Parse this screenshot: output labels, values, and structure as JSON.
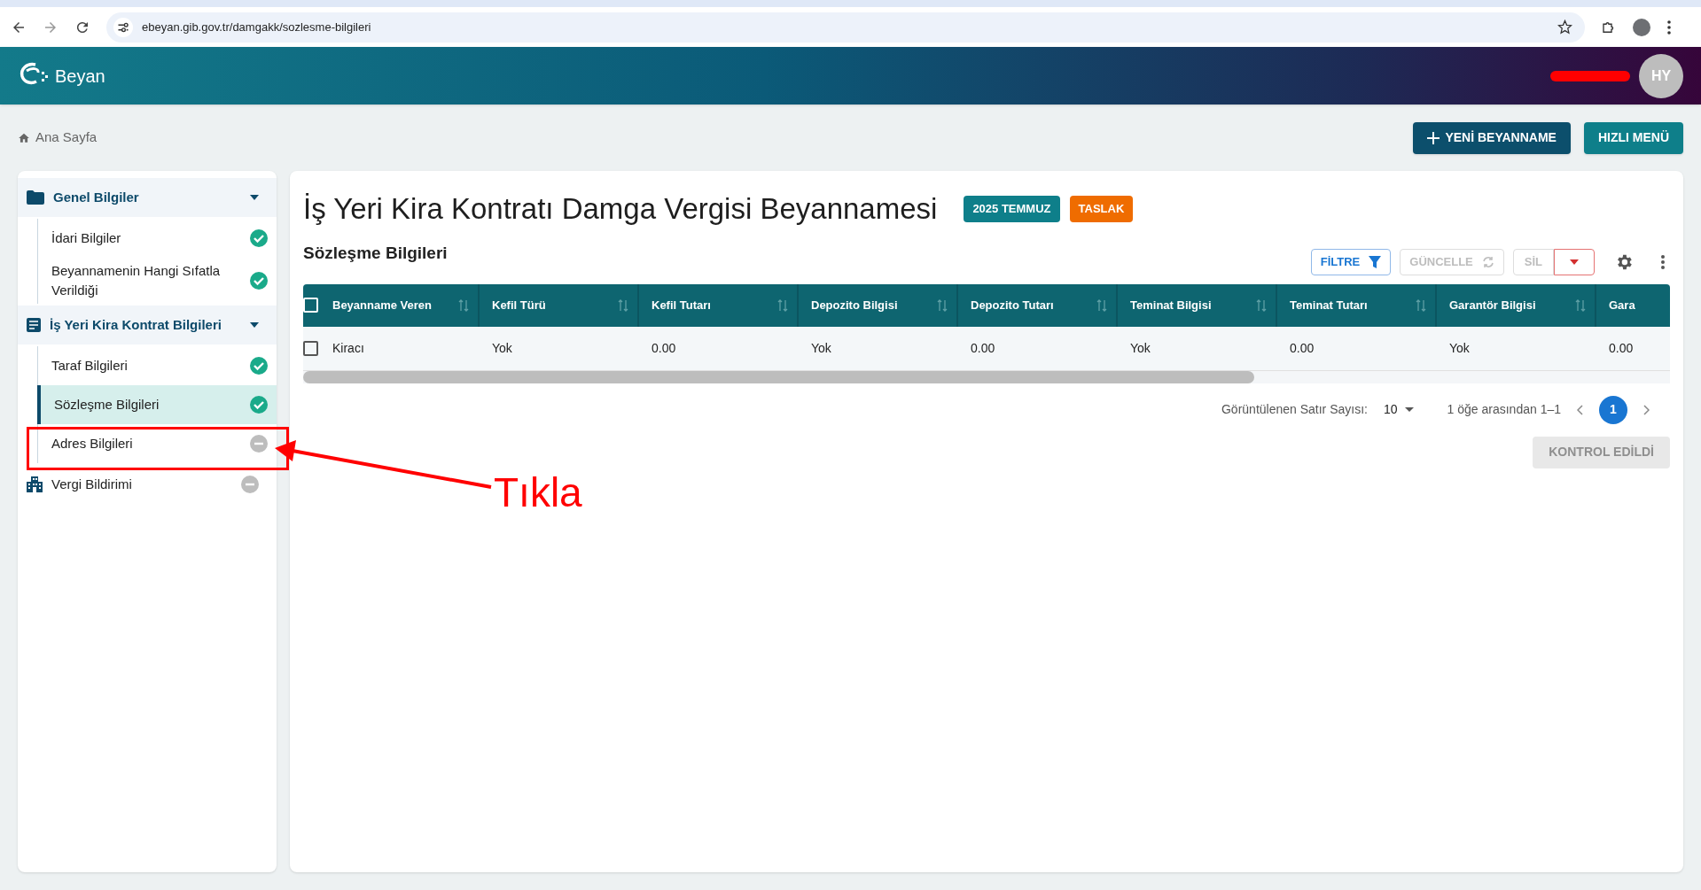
{
  "browser": {
    "url": "ebeyan.gib.gov.tr/damgakk/sozlesme-bilgileri"
  },
  "header": {
    "brand": "Beyan",
    "avatar": "HY"
  },
  "breadcrumb": "Ana Sayfa",
  "actions": [
    {
      "label": "YENİ BEYANNAME",
      "kind": "primary"
    },
    {
      "label": "HIZLI MENÜ",
      "kind": "secondary"
    }
  ],
  "sidebar": [
    {
      "label": "Genel Bilgiler",
      "expanded": true,
      "children": [
        {
          "label": "İdari Bilgiler",
          "completed": true,
          "selected": false
        },
        {
          "label": "Beyannamenin Hangi Sıfatla Verildiği",
          "completed": true,
          "selected": false
        }
      ]
    },
    {
      "label": "İş Yeri Kira Kontrat Bilgileri",
      "expanded": true,
      "children": [
        {
          "label": "Taraf Bilgileri",
          "completed": true,
          "selected": false
        },
        {
          "label": "Sözleşme Bilgileri",
          "completed": true,
          "selected": true
        },
        {
          "label": "Adres Bilgileri",
          "completed": false,
          "selected": false
        }
      ]
    },
    {
      "label": "Vergi Bildirimi",
      "completed": false,
      "selected": false
    }
  ],
  "main": {
    "title": "İş Yeri Kira Kontratı Damga Vergisi Beyannamesi",
    "badges": [
      {
        "label": "2025 TEMMUZ",
        "color": "#0e7f8a"
      },
      {
        "label": "TASLAK",
        "color": "#ef6c00"
      }
    ],
    "section": "Sözleşme Bilgileri",
    "toolbar": [
      {
        "label": "FİLTRE",
        "kind": "filter",
        "disabled": false
      },
      {
        "label": "GÜNCELLE",
        "kind": "refresh",
        "disabled": true
      },
      {
        "label": "SİL",
        "kind": "delete",
        "disabled": true
      }
    ],
    "table": {
      "all_checked": false,
      "columns": [
        "Beyanname Veren",
        "Kefil Türü",
        "Kefil Tutarı",
        "Depozito Bilgisi",
        "Depozito Tutarı",
        "Teminat Bilgisi",
        "Teminat Tutarı",
        "Garantör Bilgisi",
        "Gara"
      ],
      "rows": [
        {
          "selected": false,
          "cells": [
            "Kiracı",
            "Yok",
            "0.00",
            "Yok",
            "0.00",
            "Yok",
            "0.00",
            "Yok",
            "0.00"
          ]
        }
      ]
    },
    "pagination": {
      "label": "Görüntülenen Satır Sayısı:",
      "page_size": "10",
      "range": "1 öğe arasından 1–1",
      "pages": [
        {
          "label": "1",
          "selected": true
        }
      ]
    },
    "submit": {
      "label": "KONTROL EDİLDİ",
      "disabled": true
    }
  },
  "annotation": {
    "label": "Tıkla"
  }
}
